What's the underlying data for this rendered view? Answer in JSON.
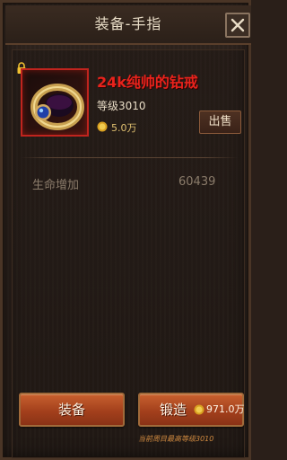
{
  "window": {
    "title": "装备-手指",
    "close_icon": "close-icon"
  },
  "item": {
    "name": "24k纯帅的钻戒",
    "level": "等级3010",
    "price": "5.0万",
    "rarity_color": "#e8231c",
    "icon": "ring-icon",
    "locked_icon": "lock-icon"
  },
  "actions": {
    "sell": "出售",
    "equip": "装备",
    "forge": "锻造",
    "forge_cost": "971.0万"
  },
  "stats": [
    {
      "label": "生命增加",
      "value": "60439"
    }
  ],
  "footer_note": "当前周目最高等级3010",
  "colors": {
    "accent_button": "#b8522a",
    "gold": "#e0c070"
  }
}
